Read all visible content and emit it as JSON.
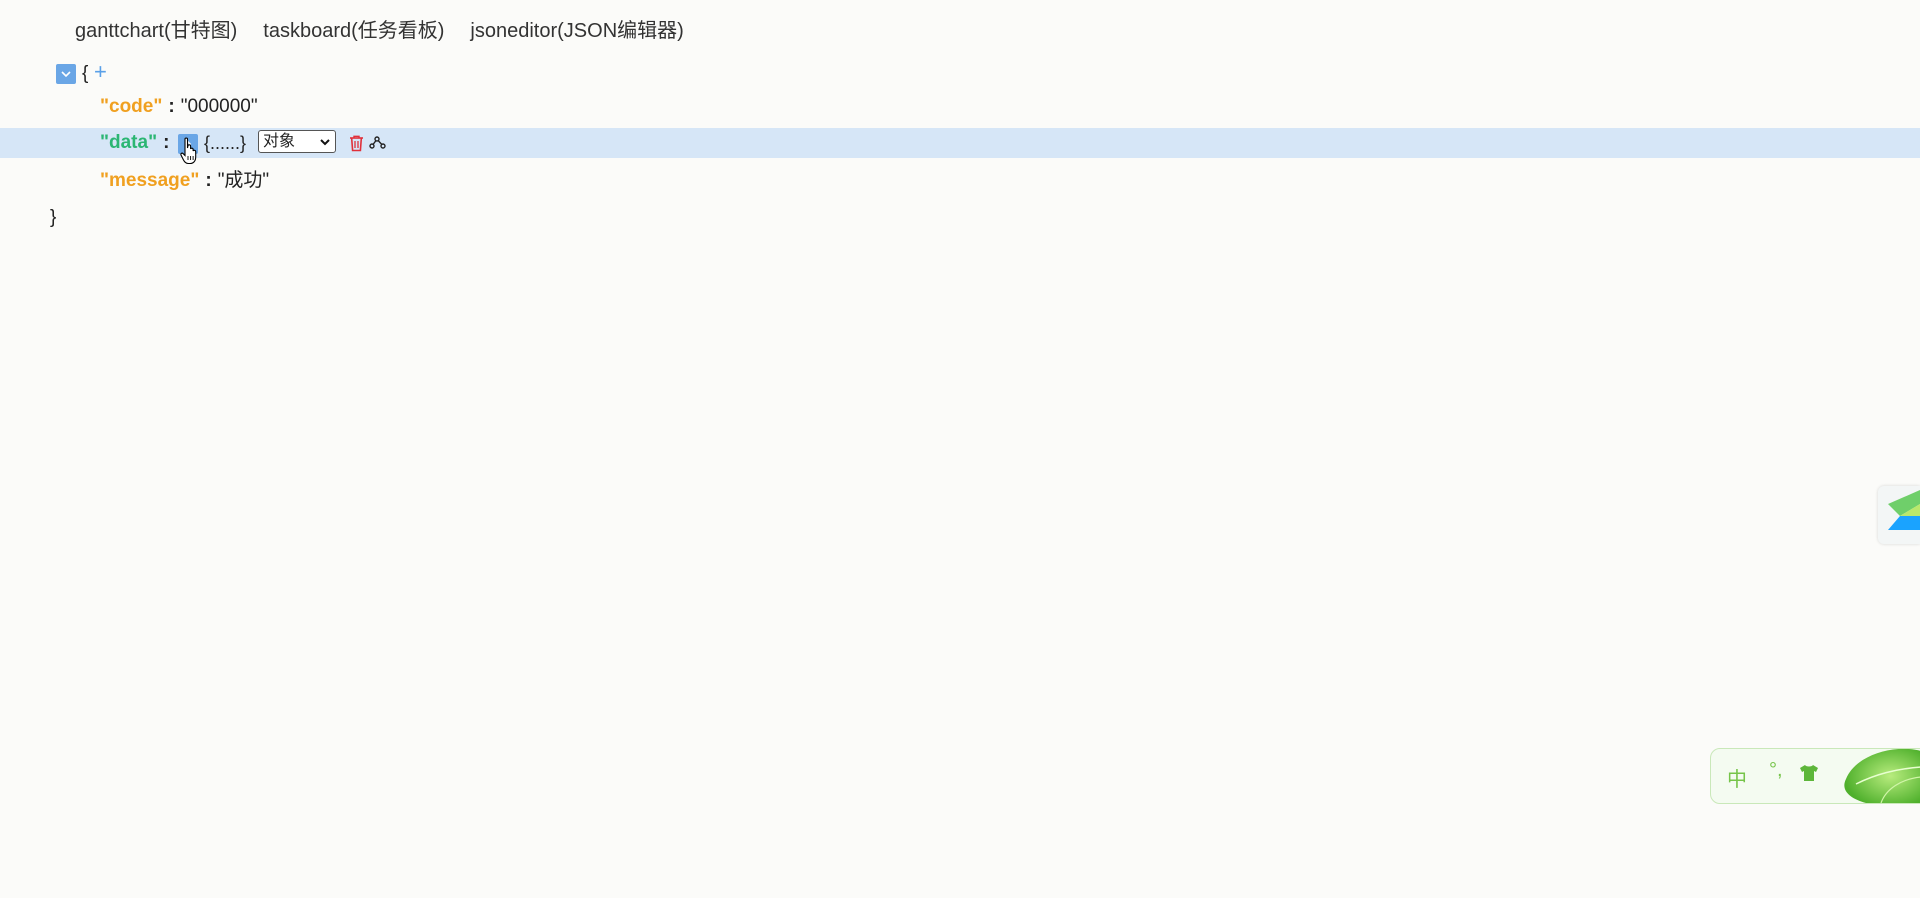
{
  "nav": {
    "items": [
      "ganttchart(甘特图)",
      "taskboard(任务看板)",
      "jsoneditor(JSON编辑器)"
    ]
  },
  "json": {
    "open_brace": "{",
    "add_symbol": "+",
    "rows": [
      {
        "key": "\"code\"",
        "value": "\"000000\""
      },
      {
        "key": "\"data\"",
        "collapsed": "{......}",
        "type_option": "对象"
      },
      {
        "key": "\"message\"",
        "value": "\"成功\""
      }
    ],
    "colon": ":",
    "close_brace": "}"
  },
  "ime": {
    "mode": "中",
    "punct": "°,"
  },
  "colors": {
    "toggle": "#6aa6e6",
    "highlight": "#d6e6f7",
    "key_orange": "#f0a020",
    "key_green": "#2bb673",
    "delete_red": "#e0303a",
    "ime_green": "#76c44a"
  },
  "icons": {
    "toggle_open": "chevron-down-icon",
    "toggle_closed": "chevron-right-icon",
    "delete": "trash-icon",
    "share": "share-nodes-icon",
    "cursor": "hand-pointer-icon"
  }
}
